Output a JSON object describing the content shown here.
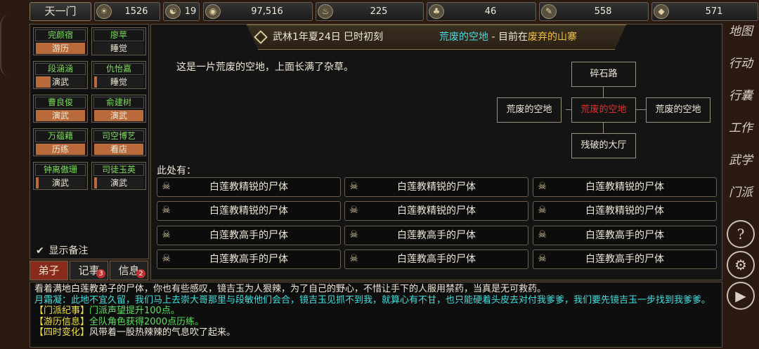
{
  "top_bar": {
    "sect_name": "天一门",
    "resources": [
      {
        "icon": "prestige-icon",
        "glyph": "☀",
        "value": "1526"
      },
      {
        "icon": "yin-yang-icon",
        "glyph": "☯",
        "value": "19"
      },
      {
        "icon": "coin-icon",
        "glyph": "◉",
        "value": "97,516"
      },
      {
        "icon": "food-bowl-icon",
        "glyph": "♨",
        "value": "225"
      },
      {
        "icon": "herb-icon",
        "glyph": "♣",
        "value": "46"
      },
      {
        "icon": "scroll-icon",
        "glyph": "✎",
        "value": "558"
      },
      {
        "icon": "ore-icon",
        "glyph": "◆",
        "value": "571"
      }
    ]
  },
  "disciples": [
    {
      "name": "完颜宿",
      "status": "游历",
      "color": "green",
      "fill": 1.0
    },
    {
      "name": "廖苹",
      "status": "睡觉",
      "color": "green",
      "fill": 0.0
    },
    {
      "name": "段涵涵",
      "status": "演武",
      "color": "green",
      "fill": 0.3
    },
    {
      "name": "仇怡嘉",
      "status": "睡觉",
      "color": "green",
      "fill": 0.05
    },
    {
      "name": "曹良俊",
      "status": "演武",
      "color": "green",
      "fill": 1.0
    },
    {
      "name": "俞建树",
      "status": "演武",
      "color": "green",
      "fill": 1.0
    },
    {
      "name": "万蕴藉",
      "status": "历练",
      "color": "green",
      "fill": 1.0
    },
    {
      "name": "司空博艺",
      "status": "看店",
      "color": "green",
      "fill": 1.0
    },
    {
      "name": "钟离傲珊",
      "status": "演武",
      "color": "green",
      "fill": 0.05
    },
    {
      "name": "司徒玉英",
      "status": "演武",
      "color": "green",
      "fill": 0.05
    }
  ],
  "show_notes_label": "显示备注",
  "tabs": [
    {
      "label": "弟子",
      "badge": ""
    },
    {
      "label": "记事",
      "badge": "3"
    },
    {
      "label": "信息",
      "badge": "2"
    }
  ],
  "header": {
    "date": "武林1年夏24日 巳时初刻",
    "place": "荒废的空地",
    "sep": " - 目前在",
    "area": "废弃的山寨"
  },
  "description": "这是一片荒废的空地，上面长满了杂草。",
  "map": {
    "north": "碎石路",
    "west": "荒废的空地",
    "current": "荒废的空地",
    "east": "荒废的空地",
    "south": "残破的大厅"
  },
  "here_label": "此处有：",
  "objects": [
    "白莲教精锐的尸体",
    "白莲教精锐的尸体",
    "白莲教精锐的尸体",
    "白莲教精锐的尸体",
    "白莲教精锐的尸体",
    "白莲教精锐的尸体",
    "白莲教高手的尸体",
    "白莲教高手的尸体",
    "白莲教高手的尸体",
    "白莲教高手的尸体",
    "白莲教高手的尸体",
    "白莲教高手的尸体"
  ],
  "log": {
    "line1": "看着满地白莲教弟子的尸体，你也有些感叹，镜吉玉为人狠辣，为了自己的野心，不惜让手下的人服用禁药，当真是无可救药。",
    "line2_speaker": "月霜凝：",
    "line2_text": "此地不宜久留，我们马上去崇大哥那里与段敏他们会合，镜吉玉见抓不到我，就算心有不甘，也只能硬着头皮去对付我爹爹，我们要先镜吉玉一步找到我爹爹。",
    "line3_tag": "【门派纪事】",
    "line3_text": "门派声望提升100点。",
    "line4_tag": "【游历信息】",
    "line4_text": "全队角色获得2000点历练。",
    "line5_tag": "【四时变化】",
    "line5_text": "风带着一股热辣辣的气息吹了起来。"
  },
  "right_menu": [
    {
      "name": "map-button",
      "label": "地图"
    },
    {
      "name": "action-button",
      "label": "行动"
    },
    {
      "name": "bag-button",
      "label": "行囊"
    },
    {
      "name": "work-button",
      "label": "工作"
    },
    {
      "name": "martial-button",
      "label": "武学"
    },
    {
      "name": "sect-button",
      "label": "门派"
    }
  ],
  "right_icons": [
    {
      "name": "help-icon",
      "glyph": "?"
    },
    {
      "name": "settings-gear-icon",
      "glyph": "⚙"
    },
    {
      "name": "play-next-icon",
      "glyph": "▶"
    }
  ]
}
